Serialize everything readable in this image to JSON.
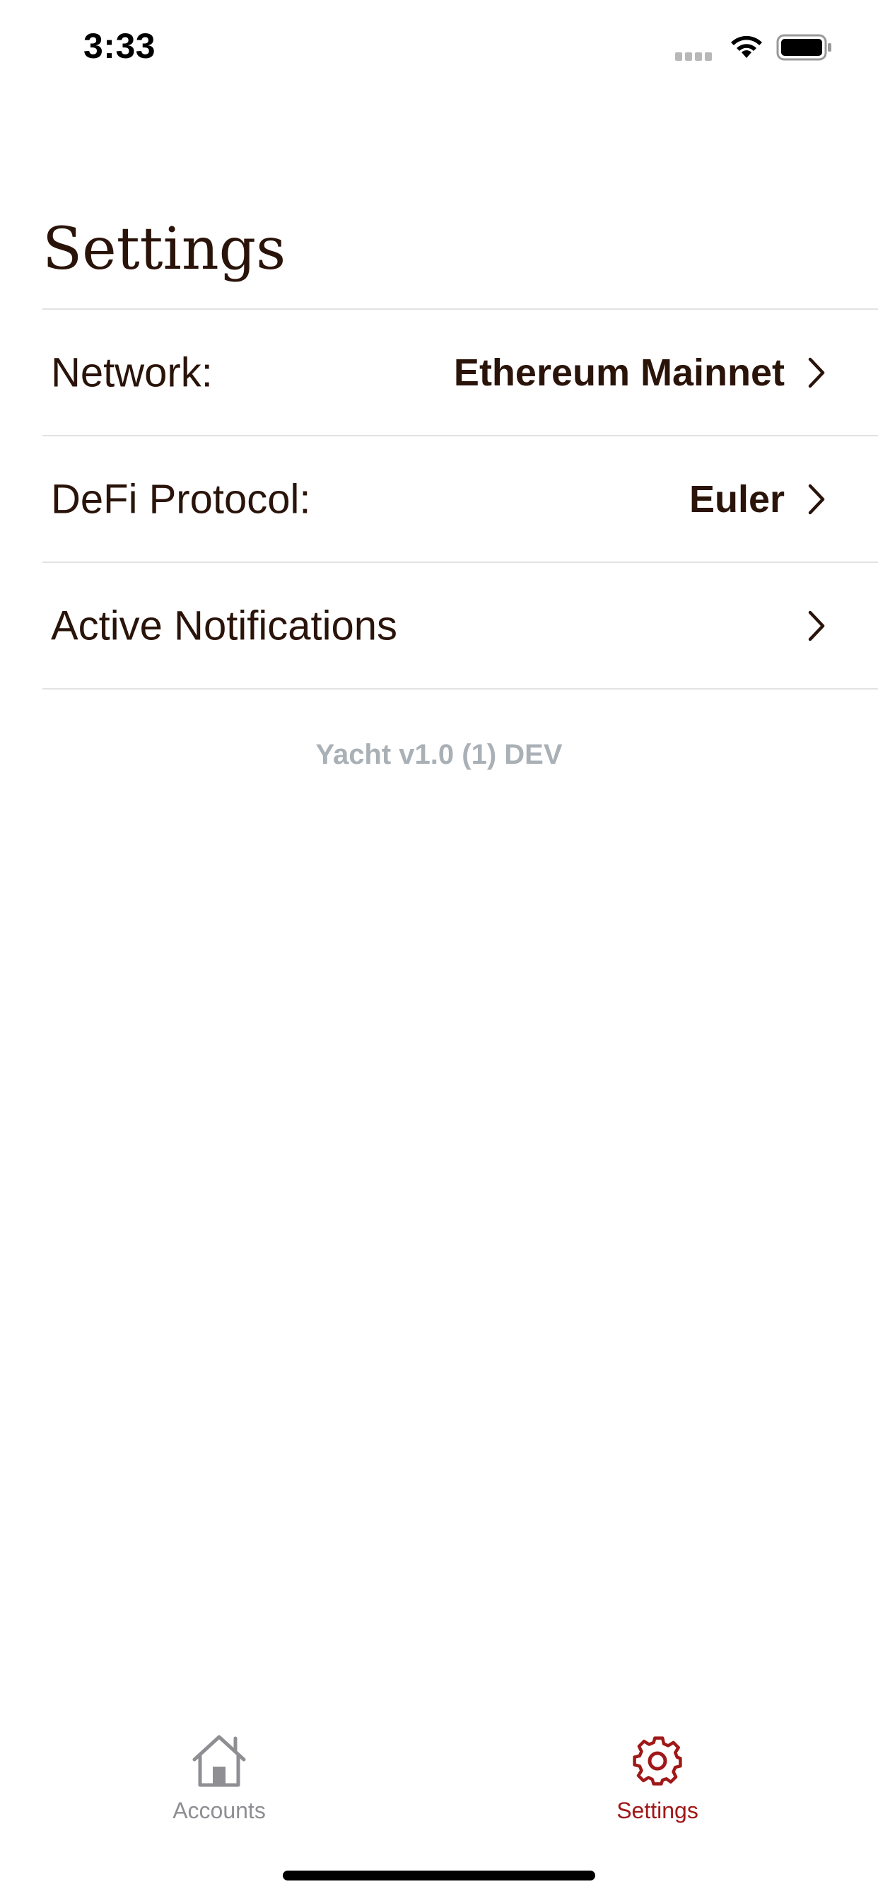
{
  "status_bar": {
    "time": "3:33"
  },
  "page": {
    "title": "Settings"
  },
  "settings_rows": [
    {
      "label": "Network:",
      "value": "Ethereum Mainnet"
    },
    {
      "label": "DeFi Protocol:",
      "value": "Euler"
    },
    {
      "label": "Active Notifications",
      "value": ""
    }
  ],
  "version_text": "Yacht v1.0 (1) DEV",
  "tabs": [
    {
      "label": "Accounts",
      "icon": "home-icon",
      "selected": false
    },
    {
      "label": "Settings",
      "icon": "gear-icon",
      "selected": true
    }
  ],
  "colors": {
    "text_primary": "#2a140a",
    "accent": "#a01818",
    "tab_inactive": "#8e8e93",
    "version_gray": "#a9b0b6",
    "divider": "#e2e2e2"
  }
}
